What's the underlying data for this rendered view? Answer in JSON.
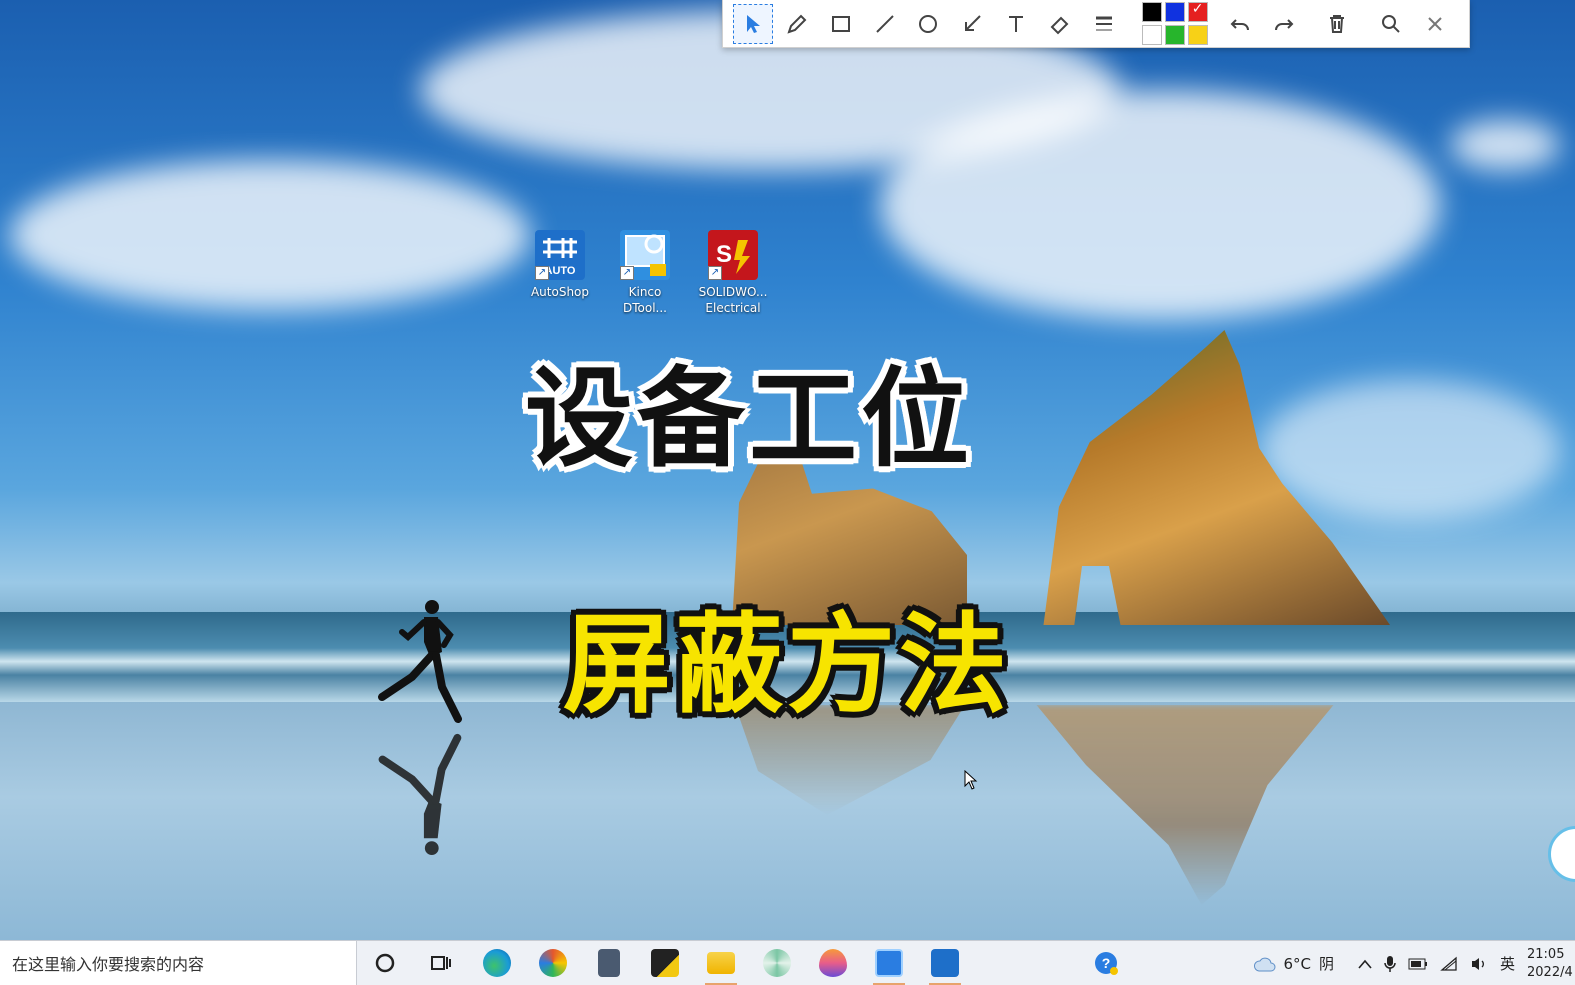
{
  "desktop": {
    "icons": [
      {
        "label_line1": "AutoShop",
        "label_line2": "",
        "icon": "autoshop-icon",
        "color": "#1e6fc9"
      },
      {
        "label_line1": "Kinco",
        "label_line2": "DTool...",
        "icon": "kinco-dtool-icon",
        "color": "#2f8fe0"
      },
      {
        "label_line1": "SOLIDWO...",
        "label_line2": "Electrical",
        "icon": "solidworks-electrical-icon",
        "color": "#c4161c"
      }
    ]
  },
  "captions": {
    "main": "设备工位",
    "sub": "屏蔽方法"
  },
  "toolbar": {
    "tools": [
      "select-tool",
      "pen-tool",
      "rectangle-tool",
      "line-tool",
      "circle-tool",
      "arrow-tool",
      "text-tool",
      "eraser-tool",
      "line-width-tool"
    ],
    "palette": [
      "#000000",
      "#1032e0",
      "#e52020",
      "#ffffff",
      "#27b52c",
      "#f7d117"
    ],
    "selected_color": "#e52020",
    "actions": [
      "undo",
      "redo",
      "delete",
      "zoom",
      "close"
    ]
  },
  "taskbar": {
    "search_placeholder": "在这里输入你要搜索的内容",
    "apps": [
      {
        "icon": "cortana-icon"
      },
      {
        "icon": "task-view-icon"
      },
      {
        "icon": "edge-icon",
        "color": "#1a9bd7"
      },
      {
        "icon": "paint-icon",
        "color": "#e4572e"
      },
      {
        "icon": "calculator-icon",
        "color": "#4a5a70"
      },
      {
        "icon": "sticky-notes-icon",
        "color": "#f2c811"
      },
      {
        "icon": "file-explorer-icon",
        "color": "#f0b400"
      },
      {
        "icon": "pinwheel-app-icon",
        "color": "#7bc6a4"
      },
      {
        "icon": "flame-app-icon",
        "color": "#e85d8a"
      },
      {
        "icon": "screenshot-app-icon",
        "color": "#2a7de1"
      },
      {
        "icon": "autoshop-taskbar-icon",
        "color": "#1e6fc9"
      }
    ],
    "help_icon": "help-icon",
    "weather_temp": "6°C",
    "weather_desc": "阴",
    "ime_lang": "英",
    "clock_time": "21:05",
    "clock_date": "2022/4"
  }
}
